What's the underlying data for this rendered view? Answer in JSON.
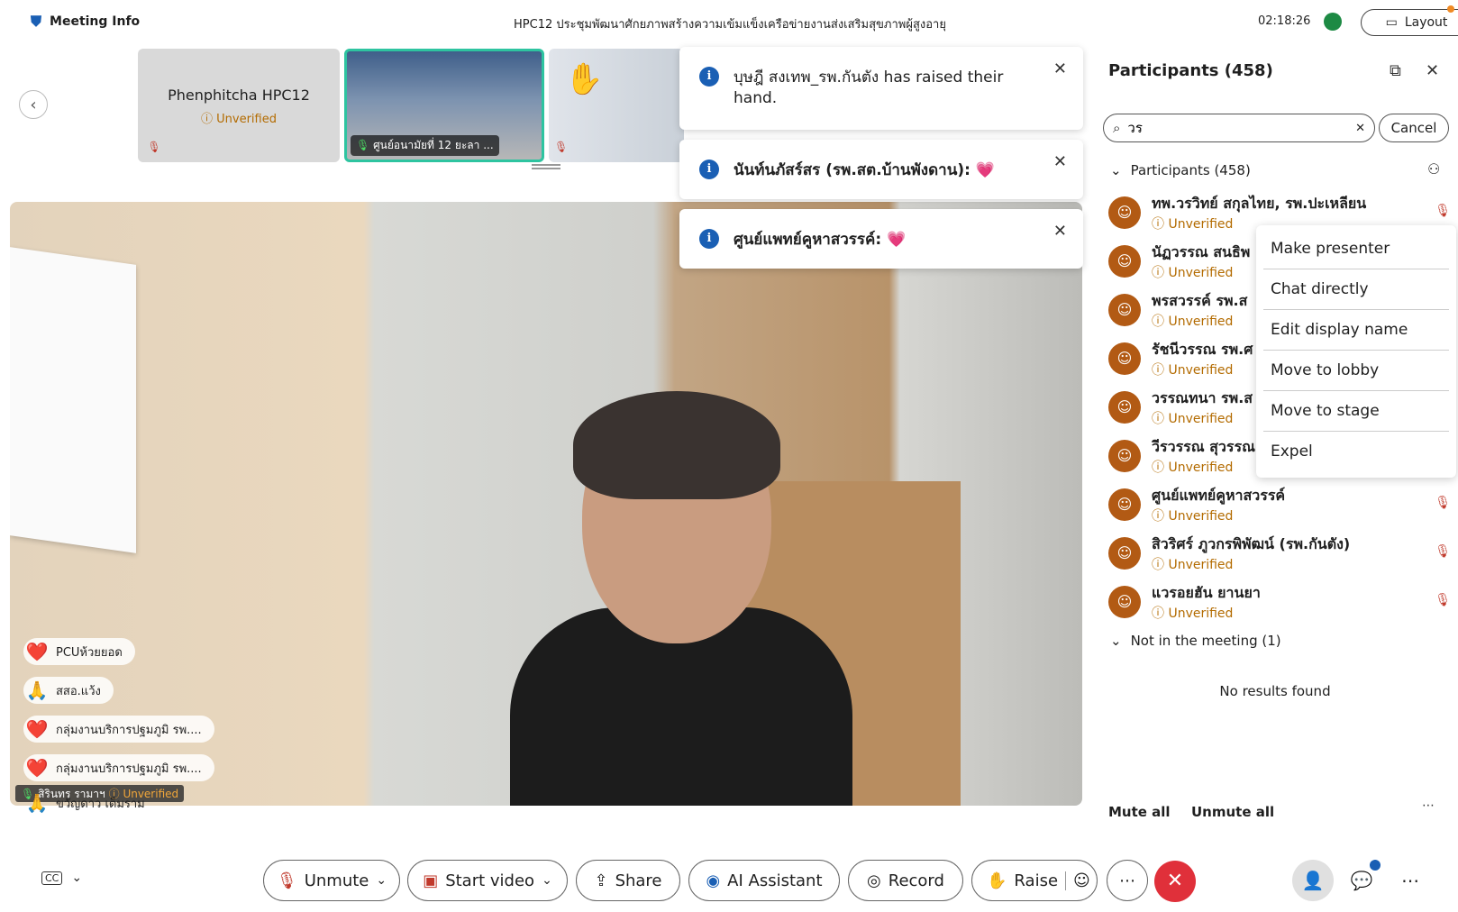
{
  "topbar": {
    "meeting_info": "Meeting Info",
    "title": "HPC12 ประชุมพัฒนาศักยภาพสร้างความเข้มแข็งเครือข่ายงานส่งเสริมสุขภาพผู้สูงอายุ",
    "timer": "02:18:26",
    "layout_label": "Layout"
  },
  "filmstrip": [
    {
      "name": "Phenphitcha HPC12",
      "status": "Unverified"
    },
    {
      "name": "ศูนย์อนามัยที่ 12 ยะลา",
      "status": "..."
    },
    {
      "name": "",
      "status": ""
    }
  ],
  "toasts": [
    {
      "text": "บุษฎี สงเทพ_รพ.กันตัง has raised their hand."
    },
    {
      "text": "นันท์นภัสร์สร (รพ.สต.บ้านพังดาน): 💗"
    },
    {
      "text": "ศูนย์แพทย์คูหาสวรรค์: 💗"
    }
  ],
  "reactions": [
    {
      "emoji": "❤️",
      "name": "PCUห้วยยอด"
    },
    {
      "emoji": "🙏",
      "name": "สสอ.แว้ง"
    },
    {
      "emoji": "❤️",
      "name": "กลุ่มงานบริการปฐมภูมิ รพ...."
    },
    {
      "emoji": "❤️",
      "name": "กลุ่มงานบริการปฐมภูมิ รพ...."
    },
    {
      "emoji": "🙏",
      "name": "ขวัญดาว เต็มราม"
    }
  ],
  "main_speaker": {
    "name": "สิรินทร รามาฯ",
    "status": "Unverified"
  },
  "panel": {
    "title": "Participants (458)",
    "search_value": "วร",
    "cancel_label": "Cancel",
    "section_label": "Participants (458)",
    "participants": [
      {
        "name": "ทพ.วรวิทย์ สกุลไทย, รพ.ปะเหลียน",
        "status": "Unverified"
      },
      {
        "name": "นัฏวรรณ สนธิพ",
        "status": "Unverified"
      },
      {
        "name": "พรสวรรค์ รพ.ส",
        "status": "Unverified"
      },
      {
        "name": "รัชนีวรรณ รพ.ศ",
        "status": "Unverified"
      },
      {
        "name": "วรรณทนา รพ.ส",
        "status": "Unverified"
      },
      {
        "name": "วีรวรรณ สุวรรณ",
        "status": "Unverified"
      },
      {
        "name": "ศูนย์แพทย์คูหาสวรรค์",
        "status": "Unverified"
      },
      {
        "name": "สิวริศร์ ภูวกรพิพัฒน์ (รพ.กันตัง)",
        "status": "Unverified"
      },
      {
        "name": "แวรอยฮัน  ยานยา",
        "status": "Unverified"
      }
    ],
    "not_in_meeting": "Not in the meeting (1)",
    "no_results": "No results found",
    "mute_all": "Mute all",
    "unmute_all": "Unmute all"
  },
  "context_menu": [
    "Make presenter",
    "Chat directly",
    "Edit display name",
    "Move to lobby",
    "Move to stage",
    "Expel"
  ],
  "toolbar": {
    "unmute": "Unmute",
    "start_video": "Start video",
    "share": "Share",
    "ai_assistant": "AI Assistant",
    "record": "Record",
    "raise": "Raise"
  },
  "colors": {
    "end_call": "#e0303a",
    "unverified": "#b36b00",
    "accent": "#1a5fb4"
  }
}
